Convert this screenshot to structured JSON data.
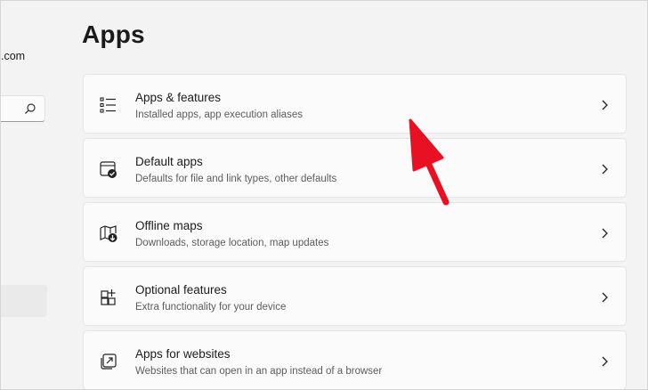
{
  "sidebar": {
    "account_email_fragment": ".com",
    "search_icon": "search-icon"
  },
  "page": {
    "title": "Apps"
  },
  "items": [
    {
      "title": "Apps & features",
      "subtitle": "Installed apps, app execution aliases",
      "icon": "apps-features-list-icon"
    },
    {
      "title": "Default apps",
      "subtitle": "Defaults for file and link types, other defaults",
      "icon": "default-apps-icon"
    },
    {
      "title": "Offline maps",
      "subtitle": "Downloads, storage location, map updates",
      "icon": "offline-maps-icon"
    },
    {
      "title": "Optional features",
      "subtitle": "Extra functionality for your device",
      "icon": "optional-features-icon"
    },
    {
      "title": "Apps for websites",
      "subtitle": "Websites that can open in an app instead of a browser",
      "icon": "apps-for-websites-icon"
    }
  ],
  "colors": {
    "background": "#f3f3f3",
    "card": "#fbfbfb",
    "annotation_arrow": "#e81123"
  }
}
